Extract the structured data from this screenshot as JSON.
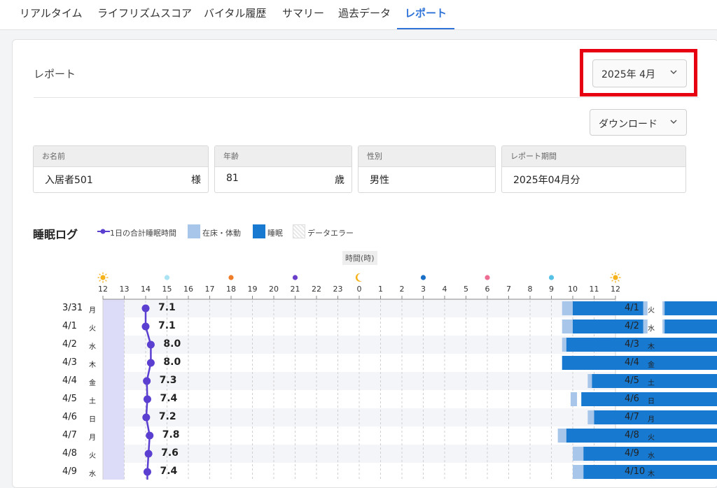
{
  "nav": {
    "tabs": [
      {
        "label": "リアルタイム"
      },
      {
        "label": "ライフリズムスコア"
      },
      {
        "label": "バイタル履歴"
      },
      {
        "label": "サマリー"
      },
      {
        "label": "過去データ"
      },
      {
        "label": "レポート"
      }
    ],
    "active_index": 5
  },
  "report": {
    "title": "レポート",
    "month_select": "2025年 4月",
    "download_label": "ダウンロード"
  },
  "info": {
    "name": {
      "label": "お名前",
      "value": "入居者501",
      "unit": "様"
    },
    "age": {
      "label": "年齢",
      "value": "81",
      "unit": "歳"
    },
    "gender": {
      "label": "性別",
      "value": "男性"
    },
    "period": {
      "label": "レポート期間",
      "value": "2025年04月分"
    }
  },
  "sleep_log": {
    "title": "睡眠ログ",
    "legend": {
      "total": "1日の合計睡眠時間",
      "in_bed": "在床・体動",
      "sleep": "睡眠",
      "error": "データエラー"
    },
    "axis_title": "時間(時)",
    "colors": {
      "line": "#5b3fd1",
      "in_bed": "#a8c6ea",
      "sleep": "#1779d0",
      "left_band": "#dcdcf8"
    },
    "ticks": [
      "12",
      "13",
      "14",
      "15",
      "16",
      "17",
      "18",
      "19",
      "20",
      "21",
      "22",
      "23",
      "0",
      "1",
      "2",
      "3",
      "4",
      "5",
      "6",
      "7",
      "8",
      "9",
      "10",
      "11",
      "12"
    ]
  },
  "chart_data": {
    "type": "timeline",
    "x_axis_hours_from_noon": [
      0,
      24
    ],
    "rows": [
      {
        "date": "3/31",
        "dow": "月",
        "right_date": "4/1",
        "right_dow": "火",
        "total": "7.1",
        "sleep": [
          [
            22.0,
            25.3
          ],
          [
            26.3,
            29.9
          ]
        ],
        "in_bed": [
          [
            21.5,
            22.0
          ],
          [
            25.3,
            25.5
          ],
          [
            26.2,
            26.3
          ],
          [
            29.9,
            30.2
          ]
        ]
      },
      {
        "date": "4/1",
        "dow": "火",
        "right_date": "4/2",
        "right_dow": "水",
        "total": "7.1",
        "sleep": [
          [
            22.0,
            25.3
          ],
          [
            26.3,
            29.9
          ]
        ],
        "in_bed": [
          [
            21.5,
            22.0
          ],
          [
            25.3,
            25.5
          ],
          [
            26.2,
            26.3
          ],
          [
            29.9,
            30.2
          ]
        ]
      },
      {
        "date": "4/2",
        "dow": "水",
        "right_date": "4/3",
        "right_dow": "木",
        "total": "8.0",
        "sleep": [
          [
            21.7,
            30.3
          ]
        ],
        "in_bed": [
          [
            21.5,
            21.7
          ]
        ]
      },
      {
        "date": "4/3",
        "dow": "木",
        "right_date": "4/4",
        "right_dow": "金",
        "total": "8.0",
        "sleep": [
          [
            21.5,
            29.7
          ],
          [
            29.8,
            30.5
          ]
        ],
        "in_bed": []
      },
      {
        "date": "4/4",
        "dow": "金",
        "right_date": "4/5",
        "right_dow": "土",
        "total": "7.3",
        "sleep": [
          [
            22.9,
            30.1
          ]
        ],
        "in_bed": [
          [
            22.7,
            22.9
          ],
          [
            30.1,
            30.4
          ]
        ]
      },
      {
        "date": "4/5",
        "dow": "土",
        "right_date": "4/6",
        "right_dow": "日",
        "total": "7.4",
        "sleep": [
          [
            22.4,
            30.3
          ]
        ],
        "in_bed": [
          [
            21.9,
            22.2
          ],
          [
            30.3,
            30.6
          ]
        ]
      },
      {
        "date": "4/6",
        "dow": "日",
        "right_date": "4/7",
        "right_dow": "月",
        "total": "7.2",
        "sleep": [
          [
            23.0,
            30.2
          ]
        ],
        "in_bed": [
          [
            22.7,
            23.0
          ],
          [
            30.2,
            30.5
          ]
        ]
      },
      {
        "date": "4/7",
        "dow": "月",
        "right_date": "4/8",
        "right_dow": "火",
        "total": "7.8",
        "sleep": [
          [
            21.7,
            29.9
          ]
        ],
        "in_bed": [
          [
            21.3,
            21.7
          ],
          [
            29.9,
            30.3
          ]
        ]
      },
      {
        "date": "4/8",
        "dow": "火",
        "right_date": "4/9",
        "right_dow": "水",
        "total": "7.6",
        "sleep": [
          [
            22.5,
            29.9
          ],
          [
            30.1,
            30.3
          ]
        ],
        "in_bed": [
          [
            22.0,
            22.5
          ],
          [
            29.9,
            30.1
          ],
          [
            30.3,
            30.4
          ],
          [
            30.7,
            30.9
          ]
        ]
      },
      {
        "date": "4/9",
        "dow": "水",
        "right_date": "4/10",
        "right_dow": "木",
        "total": "7.4",
        "sleep": [
          [
            22.5,
            30.0
          ]
        ],
        "in_bed": [
          [
            22.0,
            22.5
          ],
          [
            30.1,
            30.3
          ],
          [
            30.4,
            30.6
          ]
        ]
      }
    ]
  }
}
